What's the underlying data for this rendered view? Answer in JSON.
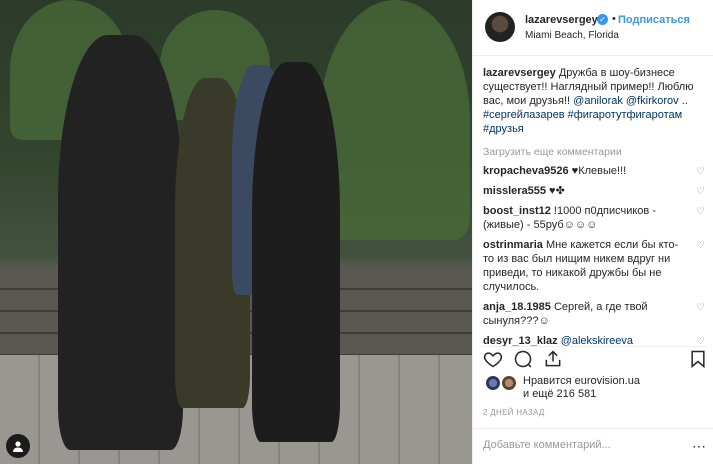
{
  "post": {
    "author": "lazarevsergey",
    "follow_label": "Подписаться",
    "location": "Miami Beach, Florida",
    "dot": "•"
  },
  "caption": {
    "username": "lazarevsergey",
    "text_1": " Дружба в шоу-бизнесе существует!! Наглядный пример!! Люблю вас, мои друзья!! ",
    "mention_1": "@anilorak",
    "mention_2": "@fkirkorov",
    "text_2": " .. ",
    "hashtags": "#сергейлазарев #фигаротутфигаротам #друзья"
  },
  "load_more": "Загрузить еще комментарии",
  "comments": [
    {
      "user": "kropacheva9526",
      "text": " ♥Клевые!!!"
    },
    {
      "user": "misslera555",
      "text": " ♥✤"
    },
    {
      "user": "boost_inst12",
      "text": " !1000 п0дписчиков - (живые) - 55руб☺☺☺"
    },
    {
      "user": "ostrinmaria",
      "text": " Мне кажется если бы кто-то из вас был нищим никем вдруг ни приведи, то никакой дружбы бы не случилось."
    },
    {
      "user": "anja_18.1985",
      "text": " Сергей, а где твой сынуля???☺"
    },
    {
      "user": "desyr_13_klaz",
      "text": " ",
      "mention": "@alekskireeva"
    }
  ],
  "likes": {
    "line_1": "Нравится eurovision.ua",
    "line_2": "и ещё 216 581"
  },
  "timestamp": "2 ДНЕЙ НАЗАД",
  "add_comment_placeholder": "Добавьте комментарий...",
  "icons": {
    "heart": "heart-icon",
    "comment": "comment-icon",
    "share": "share-icon",
    "bookmark": "bookmark-icon",
    "more": "more-icon",
    "tag": "tag-icon"
  },
  "colors": {
    "accent": "#3897f0",
    "link": "#003569",
    "muted": "#999999",
    "text": "#262626"
  }
}
